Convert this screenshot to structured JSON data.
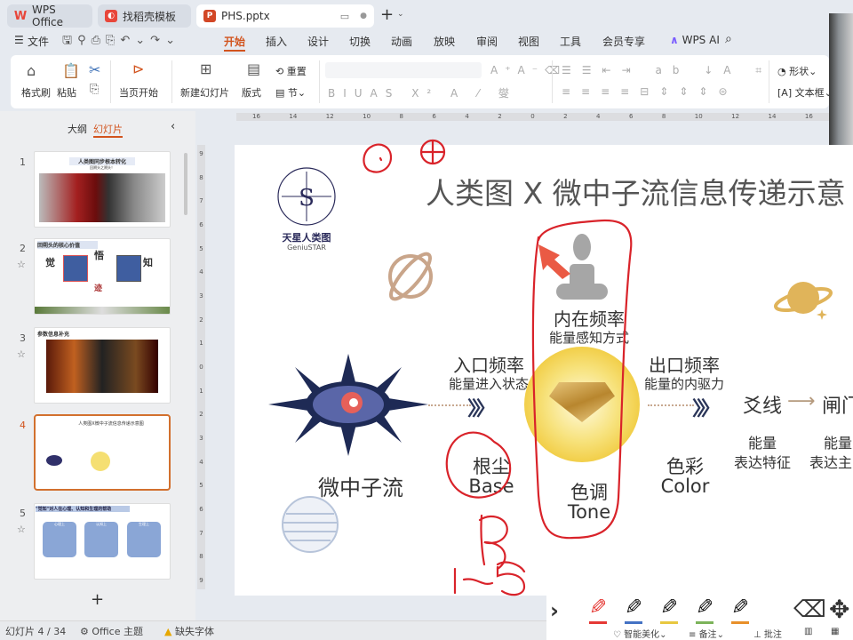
{
  "tabs": [
    {
      "label": "WPS Office",
      "icon": "wps-logo-icon",
      "color": "#e8463a"
    },
    {
      "label": "找稻壳模板",
      "icon": "docer-icon",
      "color": "#e8463a"
    },
    {
      "label": "PHS.pptx",
      "icon": "presentation-file-icon",
      "color": "#d24726"
    }
  ],
  "menu": {
    "file": "文件",
    "items": [
      "开始",
      "插入",
      "设计",
      "切换",
      "动画",
      "放映",
      "审阅",
      "视图",
      "工具",
      "会员专享"
    ],
    "active": "开始",
    "wps_ai": "WPS AI"
  },
  "ribbon": {
    "format_painter": "格式刷",
    "paste": "粘贴",
    "start_from_current": "当页开始",
    "new_slide": "新建幻灯片",
    "layout": "版式",
    "reset": "重置",
    "section": "节",
    "shape": "形状",
    "textbox": "文本框"
  },
  "panel": {
    "outline": "大纲",
    "slides": "幻灯片",
    "active": "幻灯片"
  },
  "thumbnails": [
    {
      "number": "1",
      "title": "人类图同步根本转化",
      "subtitle": "回朔头之朔头！"
    },
    {
      "number": "2",
      "title": "回朔头的核心价值",
      "words": [
        "觉",
        "悟",
        "知",
        "迹"
      ]
    },
    {
      "number": "3",
      "title": "参数信息补充"
    },
    {
      "number": "4",
      "title": "人类图X微中子流信息传递示意图"
    },
    {
      "number": "5",
      "title": "\"觉知\"对人在心理、认知和生理的帮助",
      "boxes": [
        "心理上",
        "认知上",
        "生理上"
      ]
    }
  ],
  "ruler": {
    "h": [
      "16",
      "14",
      "12",
      "10",
      "8",
      "6",
      "4",
      "2",
      "0",
      "2",
      "4",
      "6",
      "8",
      "10",
      "12",
      "14",
      "16"
    ],
    "v": [
      "9",
      "8",
      "7",
      "6",
      "5",
      "4",
      "3",
      "2",
      "1",
      "0",
      "1",
      "2",
      "3",
      "4",
      "5",
      "6",
      "7",
      "8",
      "9"
    ]
  },
  "slide": {
    "title": "人类图 X 微中子流信息传递示意",
    "logo": {
      "name": "天星人类图",
      "en": "GeniuSTAR"
    },
    "inner": {
      "title": "内在频率",
      "sub": "能量感知方式"
    },
    "entry": {
      "title": "入口频率",
      "sub": "能量进入状态"
    },
    "exit": {
      "title": "出口频率",
      "sub": "能量的内驱力"
    },
    "neutrino": "微中子流",
    "base": {
      "zh": "根尘",
      "en": "Base"
    },
    "tone": {
      "zh": "色调",
      "en": "Tone"
    },
    "color": {
      "zh": "色彩",
      "en": "Color"
    },
    "line": {
      "title": "爻线",
      "sub1": "能量",
      "sub2": "表达特征"
    },
    "gate": {
      "title": "闸门",
      "sub1": "能量",
      "sub2": "表达主"
    }
  },
  "annotation_color": "#d9232a",
  "pen_colors": [
    "#e53935",
    "#4472c4",
    "#e8c840",
    "#7cb35a",
    "#e8902a"
  ],
  "status": {
    "slide": "幻灯片 4 / 34",
    "theme": "Office 主题",
    "missing_font": "缺失字体",
    "beautify": "智能美化",
    "notes": "备注",
    "comment": "批注"
  }
}
